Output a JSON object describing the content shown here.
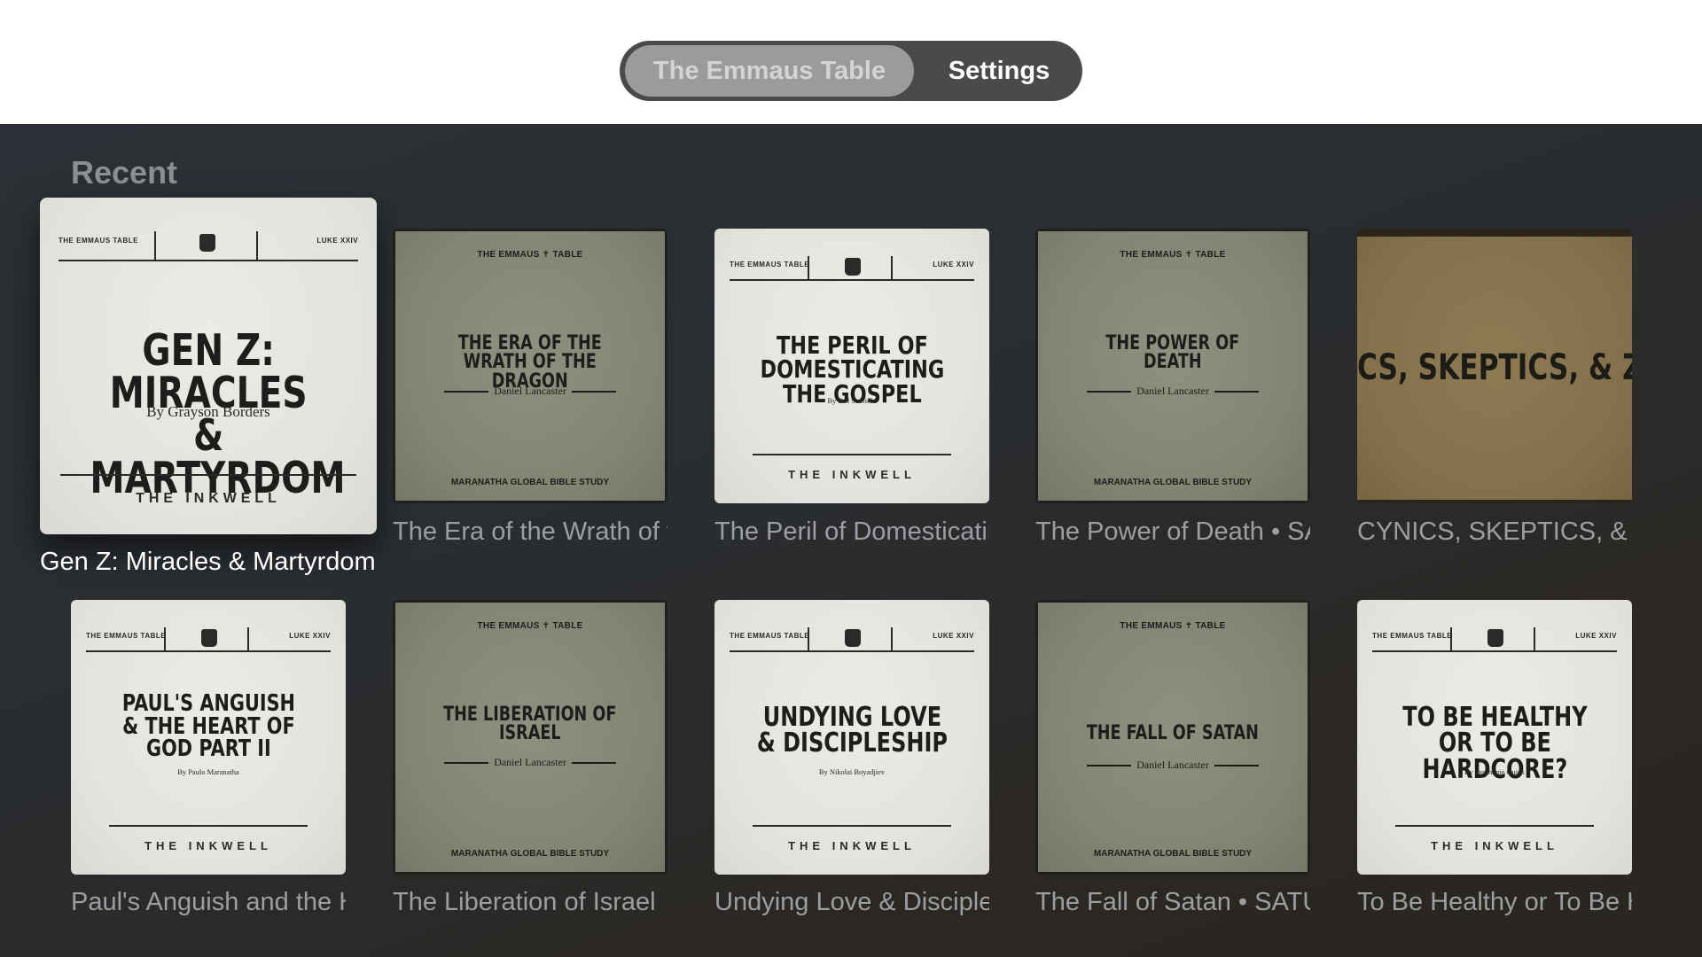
{
  "tabs": [
    {
      "label": "The Emmaus Table",
      "active": true
    },
    {
      "label": "Settings",
      "active": false
    }
  ],
  "section_title": "Recent",
  "cover_common": {
    "header_left": "THE EMMAUS TABLE",
    "header_right": "LUKE XXIV",
    "footer": "THE INKWELL",
    "olive_header": "THE EMMAUS ✝ TABLE",
    "olive_footer": "MARANATHA GLOBAL BIBLE STUDY"
  },
  "items": [
    {
      "caption": "Gen Z: Miracles & Martyrdom",
      "style": "light",
      "cover_title": "GEN Z: MIRACLES & MARTYRDOM",
      "cover_author": "By Grayson Borders",
      "focused": true
    },
    {
      "caption": "The Era of the Wrath of the Dragon",
      "style": "olive",
      "cover_title": "THE ERA OF THE WRATH OF THE DRAGON",
      "cover_author": "Daniel Lancaster"
    },
    {
      "caption": "The Peril of Domesticating the Gospel",
      "style": "light",
      "cover_title": "THE PERIL OF DOMESTICATING THE GOSPEL",
      "cover_author": "By Bill Scofield"
    },
    {
      "caption": "The Power of Death • SATURDAY",
      "style": "olive",
      "cover_title": "THE POWER OF DEATH",
      "cover_author": "Daniel Lancaster"
    },
    {
      "caption": "CYNICS, SKEPTICS, & ZION",
      "style": "tan",
      "cover_title": "CS, SKEPTICS, & ZION"
    },
    {
      "caption": "Paul's Anguish and the Heart of God Part II",
      "style": "light",
      "cover_title": "PAUL'S ANGUISH & THE HEART OF GOD PART II",
      "cover_author": "By Paulo Maranatha"
    },
    {
      "caption": "The Liberation of Israel",
      "style": "olive",
      "cover_title": "THE LIBERATION OF ISRAEL",
      "cover_author": "Daniel Lancaster"
    },
    {
      "caption": "Undying Love & Discipleship",
      "style": "light",
      "cover_title": "UNDYING LOVE & DISCIPLESHIP",
      "cover_author": "By Nikolai Boyadjiev"
    },
    {
      "caption": "The Fall of Satan • SATURDAY",
      "style": "olive",
      "cover_title": "THE FALL OF SATAN",
      "cover_author": "Daniel Lancaster"
    },
    {
      "caption": "To Be Healthy or To Be Hardcore?",
      "style": "light",
      "cover_title": "TO BE HEALTHY OR TO BE HARDCORE?",
      "cover_author": "By Stephanie Quick"
    }
  ]
}
